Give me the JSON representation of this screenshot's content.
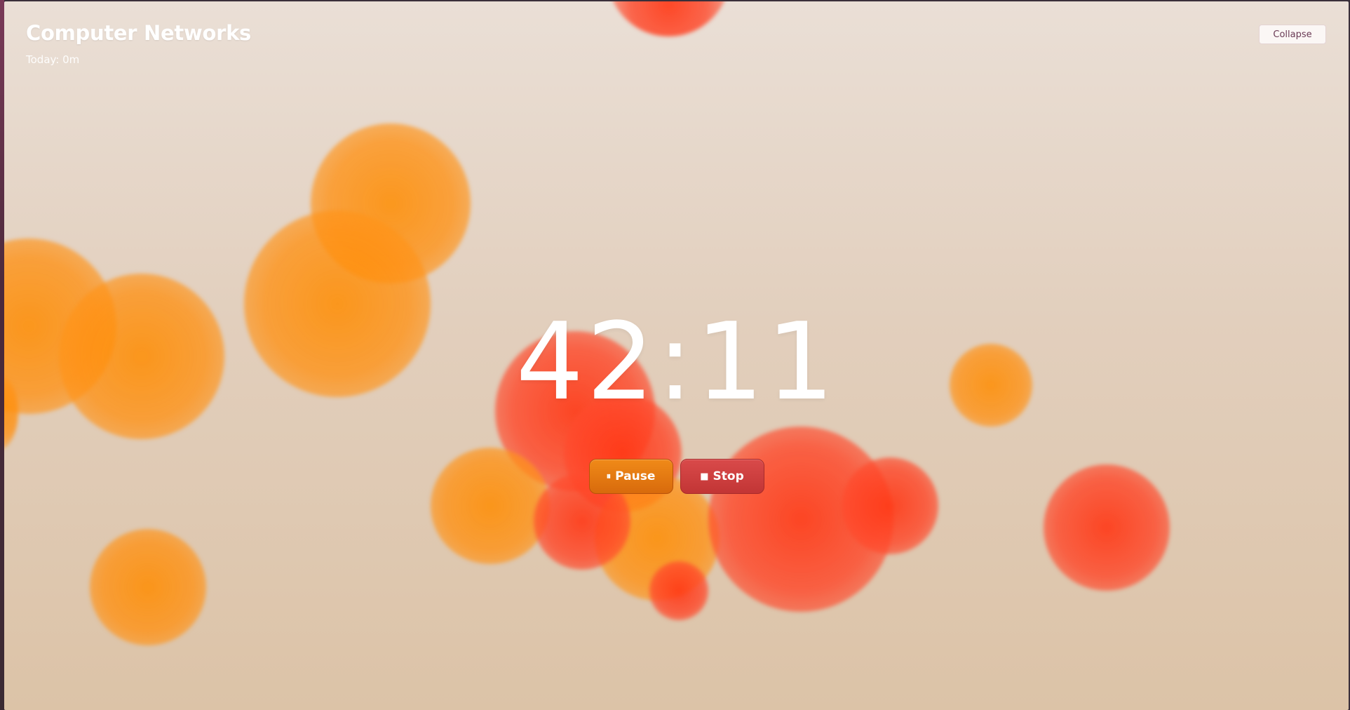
{
  "header": {
    "title": "Computer Networks",
    "today_label": "Today: 0m",
    "collapse_label": "Collapse"
  },
  "timer": {
    "display": "42:11"
  },
  "controls": {
    "pause_icon": "⏸",
    "pause_label": "Pause",
    "stop_icon": "■",
    "stop_label": "Stop"
  },
  "theme": {
    "accent_orange": "#f08a18",
    "accent_red": "#d94a4a",
    "bubble_orange": "#ff8c00",
    "bubble_red": "#ff4020"
  }
}
